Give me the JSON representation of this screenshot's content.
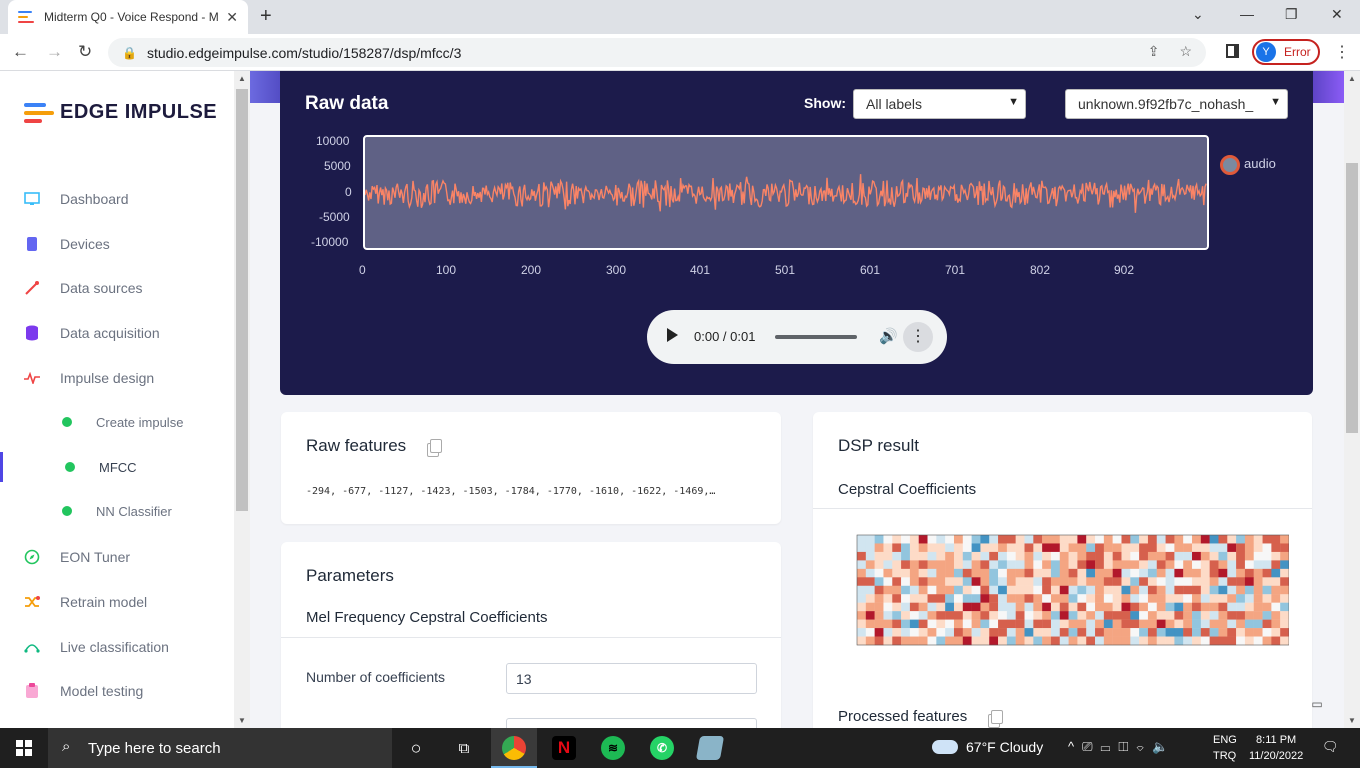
{
  "browser": {
    "tab_title": "Midterm Q0 - Voice Respond - M",
    "url": "studio.edgeimpulse.com/studio/158287/dsp/mfcc/3",
    "profile_initial": "Y",
    "profile_status": "Error"
  },
  "sidebar": {
    "brand": "EDGE IMPULSE",
    "items": [
      {
        "label": "Dashboard",
        "icon": "monitor-icon",
        "color": "#38bdf8"
      },
      {
        "label": "Devices",
        "icon": "chip-icon",
        "color": "#6366f1"
      },
      {
        "label": "Data sources",
        "icon": "wand-icon",
        "color": "#ef4444"
      },
      {
        "label": "Data acquisition",
        "icon": "database-icon",
        "color": "#7c3aed"
      },
      {
        "label": "Impulse design",
        "icon": "pulse-icon",
        "color": "#ef4444"
      },
      {
        "label": "Create impulse",
        "icon": "dot-icon",
        "color": "#22c55e"
      },
      {
        "label": "MFCC",
        "icon": "dot-icon",
        "color": "#22c55e"
      },
      {
        "label": "NN Classifier",
        "icon": "dot-icon",
        "color": "#22c55e"
      },
      {
        "label": "EON Tuner",
        "icon": "compass-icon",
        "color": "#22c55e"
      },
      {
        "label": "Retrain model",
        "icon": "shuffle-icon",
        "color": "#f59e0b"
      },
      {
        "label": "Live classification",
        "icon": "signal-icon",
        "color": "#10b981"
      },
      {
        "label": "Model testing",
        "icon": "clipboard-icon",
        "color": "#ec4899"
      }
    ]
  },
  "raw_data": {
    "title": "Raw data",
    "show_label": "Show:",
    "filter_value": "All labels",
    "sample_value": "unknown.9f92fb7c_nohash_",
    "legend": "audio",
    "audio_time": "0:00 / 0:01"
  },
  "chart_data": {
    "type": "line",
    "series": [
      {
        "name": "audio",
        "color": "#fa8466"
      }
    ],
    "x_ticks": [
      "0",
      "100",
      "200",
      "300",
      "401",
      "501",
      "601",
      "701",
      "802",
      "902"
    ],
    "y_ticks": [
      "10000",
      "5000",
      "0",
      "-5000",
      "-10000"
    ],
    "ylim": [
      -10000,
      10000
    ],
    "xlim": [
      0,
      1000
    ]
  },
  "raw_features": {
    "title": "Raw features",
    "values": "-294, -677, -1127, -1423, -1503, -1784, -1770, -1610, -1622, -1469,…"
  },
  "parameters": {
    "title": "Parameters",
    "subtitle": "Mel Frequency Cepstral Coefficients",
    "num_coeff_label": "Number of coefficients",
    "num_coeff_value": "13"
  },
  "dsp_result": {
    "title": "DSP result",
    "subtitle": "Cepstral Coefficients",
    "processed_title": "Processed features"
  },
  "taskbar": {
    "search_placeholder": "Type here to search",
    "weather": "67°F  Cloudy",
    "lang_top": "ENG",
    "lang_bottom": "TRQ",
    "time": "8:11 PM",
    "date": "11/20/2022",
    "notifications": "1"
  }
}
